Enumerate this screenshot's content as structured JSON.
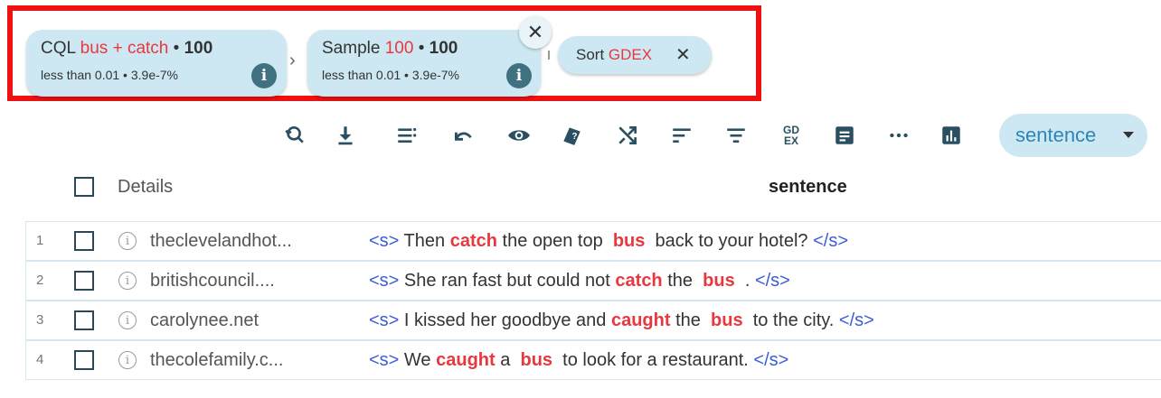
{
  "criteria": {
    "cql": {
      "prefix": "CQL",
      "query": "bus + catch",
      "sep": "•",
      "count": "100",
      "line2": "less than 0.01 • 3.9e-7%"
    },
    "sample": {
      "prefix": "Sample",
      "value": "100",
      "sep": "•",
      "count": "100",
      "line2": "less than 0.01 • 3.9e-7%"
    },
    "sort": {
      "prefix": "Sort",
      "value": "GDEX",
      "close": "✕"
    },
    "info_glyph": "i",
    "chevron": "›",
    "remove": "✕"
  },
  "toolbar": {
    "icons": [
      "search-replace-icon",
      "download-icon",
      "view-options-icon",
      "undo-icon",
      "visibility-icon",
      "label-icon",
      "shuffle-icon",
      "sort-icon",
      "filter-icon",
      "gdex-icon",
      "document-icon",
      "more-icon",
      "frequency-chart-icon"
    ],
    "gdex_top": "GD",
    "gdex_bottom": "EX",
    "view_select": "sentence"
  },
  "table": {
    "col_details": "Details",
    "col_sentence": "sentence",
    "rows": [
      {
        "num": "1",
        "source": "theclevelandhot...",
        "parts": [
          "<s>",
          " Then ",
          "catch",
          " the open top  ",
          "bus",
          "  back to your hotel? ",
          "</s>"
        ]
      },
      {
        "num": "2",
        "source": "britishcouncil....",
        "parts": [
          "<s>",
          " She ran fast but could not ",
          "catch",
          " the  ",
          "bus",
          "  . ",
          "</s>"
        ]
      },
      {
        "num": "3",
        "source": "carolynee.net",
        "parts": [
          "<s>",
          " I kissed her goodbye and ",
          "caught",
          " the  ",
          "bus",
          "  to the city. ",
          "</s>"
        ]
      },
      {
        "num": "4",
        "source": "thecolefamily.c...",
        "parts": [
          "<s>",
          " We ",
          "caught",
          " a  ",
          "bus",
          "  to look for a restaurant. ",
          "</s>"
        ]
      }
    ]
  },
  "colors": {
    "highlight": "#ee1111",
    "chip_bg": "#cde8f3",
    "keyword": "#e8383d",
    "tag": "#3b5bd9",
    "icon": "#2a4f60"
  }
}
